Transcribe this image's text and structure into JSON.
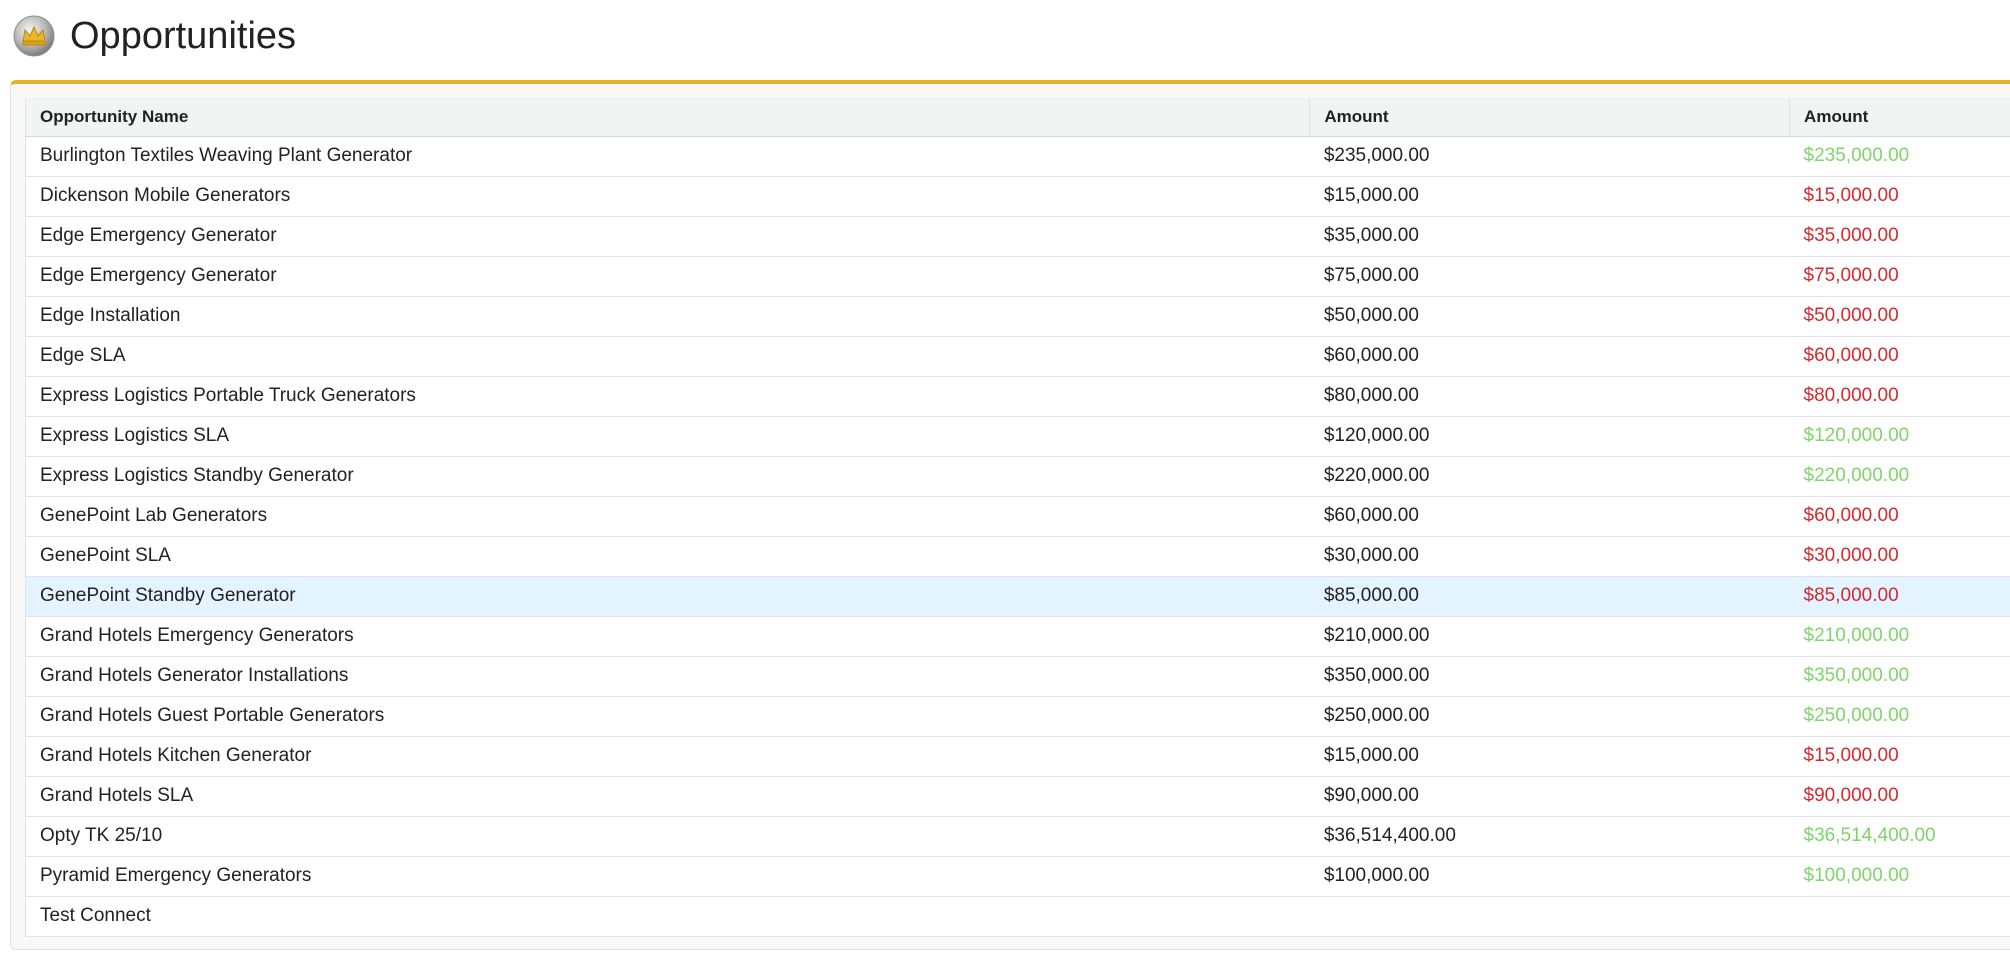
{
  "page": {
    "title": "Opportunities",
    "icon": "crown-icon"
  },
  "table": {
    "columns": [
      "Opportunity Name",
      "Amount",
      "Amount"
    ],
    "colors": {
      "positive": "#7fd36b",
      "negative": "#d42a2f",
      "highlight": "#e3f3ff",
      "accent": "#e6b325"
    },
    "rows": [
      {
        "name": "Burlington Textiles Weaving Plant Generator",
        "amount": "$235,000.00",
        "amount_colored": "$235,000.00",
        "status": "green"
      },
      {
        "name": "Dickenson Mobile Generators",
        "amount": "$15,000.00",
        "amount_colored": "$15,000.00",
        "status": "red"
      },
      {
        "name": "Edge Emergency Generator",
        "amount": "$35,000.00",
        "amount_colored": "$35,000.00",
        "status": "red"
      },
      {
        "name": "Edge Emergency Generator",
        "amount": "$75,000.00",
        "amount_colored": "$75,000.00",
        "status": "red"
      },
      {
        "name": "Edge Installation",
        "amount": "$50,000.00",
        "amount_colored": "$50,000.00",
        "status": "red"
      },
      {
        "name": "Edge SLA",
        "amount": "$60,000.00",
        "amount_colored": "$60,000.00",
        "status": "red"
      },
      {
        "name": "Express Logistics Portable Truck Generators",
        "amount": "$80,000.00",
        "amount_colored": "$80,000.00",
        "status": "red"
      },
      {
        "name": "Express Logistics SLA",
        "amount": "$120,000.00",
        "amount_colored": "$120,000.00",
        "status": "green"
      },
      {
        "name": "Express Logistics Standby Generator",
        "amount": "$220,000.00",
        "amount_colored": "$220,000.00",
        "status": "green"
      },
      {
        "name": "GenePoint Lab Generators",
        "amount": "$60,000.00",
        "amount_colored": "$60,000.00",
        "status": "red"
      },
      {
        "name": "GenePoint SLA",
        "amount": "$30,000.00",
        "amount_colored": "$30,000.00",
        "status": "red"
      },
      {
        "name": "GenePoint Standby Generator",
        "amount": "$85,000.00",
        "amount_colored": "$85,000.00",
        "status": "red",
        "highlighted": true
      },
      {
        "name": "Grand Hotels Emergency Generators",
        "amount": "$210,000.00",
        "amount_colored": "$210,000.00",
        "status": "green"
      },
      {
        "name": "Grand Hotels Generator Installations",
        "amount": "$350,000.00",
        "amount_colored": "$350,000.00",
        "status": "green"
      },
      {
        "name": "Grand Hotels Guest Portable Generators",
        "amount": "$250,000.00",
        "amount_colored": "$250,000.00",
        "status": "green"
      },
      {
        "name": "Grand Hotels Kitchen Generator",
        "amount": "$15,000.00",
        "amount_colored": "$15,000.00",
        "status": "red"
      },
      {
        "name": "Grand Hotels SLA",
        "amount": "$90,000.00",
        "amount_colored": "$90,000.00",
        "status": "red"
      },
      {
        "name": "Opty TK 25/10",
        "amount": "$36,514,400.00",
        "amount_colored": "$36,514,400.00",
        "status": "green"
      },
      {
        "name": "Pyramid Emergency Generators",
        "amount": "$100,000.00",
        "amount_colored": "$100,000.00",
        "status": "green"
      },
      {
        "name": "Test Connect",
        "amount": "",
        "amount_colored": "",
        "status": "none"
      }
    ]
  }
}
